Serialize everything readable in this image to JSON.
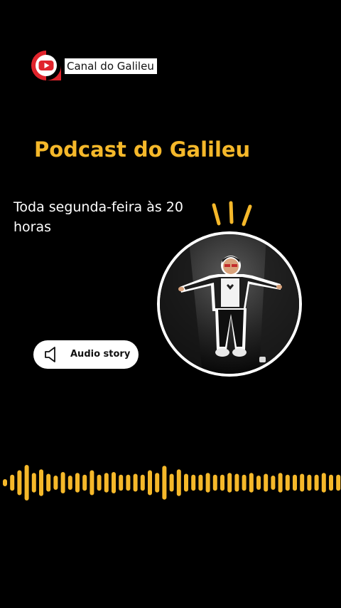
{
  "brand": {
    "name": "Canal do Galileu",
    "icon": "youtube-play-icon",
    "icon_ring_color": "#e0242c"
  },
  "podcast": {
    "title": "Podcast do Galileu",
    "schedule": "Toda segunda-feira às 20 horas"
  },
  "host_photo": {
    "icon": "host-portrait"
  },
  "audio_button": {
    "label": "Audio story",
    "icon": "speaker-icon"
  },
  "waveform": {
    "icon": "audio-waveform",
    "levels": [
      0.2,
      0.45,
      0.7,
      1.0,
      0.55,
      0.75,
      0.5,
      0.4,
      0.6,
      0.4,
      0.55,
      0.45,
      0.7,
      0.45,
      0.55,
      0.6,
      0.45,
      0.45,
      0.5,
      0.45,
      0.7,
      0.55,
      0.95,
      0.5,
      0.75,
      0.5,
      0.45,
      0.45,
      0.55,
      0.45,
      0.45,
      0.55,
      0.5,
      0.45,
      0.55,
      0.4,
      0.5,
      0.4,
      0.55,
      0.45,
      0.45,
      0.5,
      0.45,
      0.45,
      0.55,
      0.45,
      0.45,
      0.4
    ]
  },
  "colors": {
    "background": "#000000",
    "accent": "#f5b82a",
    "text": "#ffffff",
    "pill": "#ffffff",
    "pill_text": "#111111"
  }
}
